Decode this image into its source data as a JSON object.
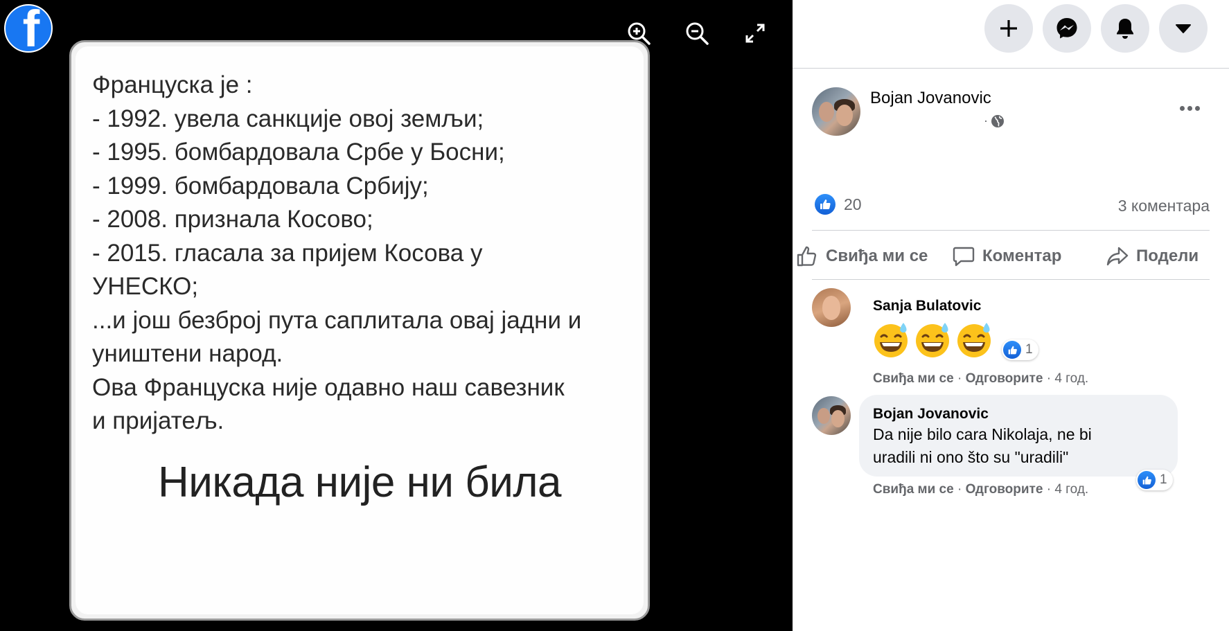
{
  "viewer": {
    "logo_letter": "f",
    "tools": [
      {
        "name": "zoom-in-icon"
      },
      {
        "name": "zoom-out-icon"
      },
      {
        "name": "fullscreen-icon"
      }
    ],
    "photo": {
      "lines": [
        "Француска је :",
        "- 1992. увела санкције овој земљи;",
        "- 1995. бомбардовала Србе у Босни;",
        "- 1999. бомбардовала Србију;",
        "- 2008. признала Косово;",
        "- 2015. гласала за пријем Косова у",
        "УНЕСКО;",
        "...и још безброј пута саплитала овај јадни и",
        "уништени народ.",
        "Ова Француска није одавно наш савезник",
        "и пријатељ."
      ],
      "caption": "Никада није ни била"
    }
  },
  "header": {
    "buttons": [
      "plus-icon",
      "messenger-icon",
      "bell-icon",
      "caret-down-icon"
    ]
  },
  "post": {
    "author": "Bojan Jovanovic",
    "meta_separator": "·",
    "privacy_icon": "globe-icon",
    "like_count": "20",
    "comment_count": "3 коментара",
    "actions": {
      "like": "Свиђа ми се",
      "comment": "Коментар",
      "share": "Подели"
    }
  },
  "comments": [
    {
      "author": "Sanja Bulatovic",
      "emoji": [
        "grinning-sweat-emoji",
        "grinning-sweat-emoji",
        "grinning-sweat-emoji"
      ],
      "reactions": "1",
      "like_label": "Свиђа ми се",
      "reply_label": "Одговорите",
      "time": "4 год."
    },
    {
      "author": "Bojan Jovanovic",
      "text_line1": "Da nije bilo cara Nikolaja, ne bi",
      "text_line2": "uradili ni ono što su \"uradili\"",
      "reactions": "1",
      "like_label": "Свиђа ми се",
      "reply_label": "Одговорите",
      "time": "4 год."
    }
  ],
  "colors": {
    "facebook_blue": "#1877f2",
    "secondary_text": "#65676b",
    "bubble_bg": "#f0f2f5",
    "button_bg": "#e4e6eb"
  }
}
